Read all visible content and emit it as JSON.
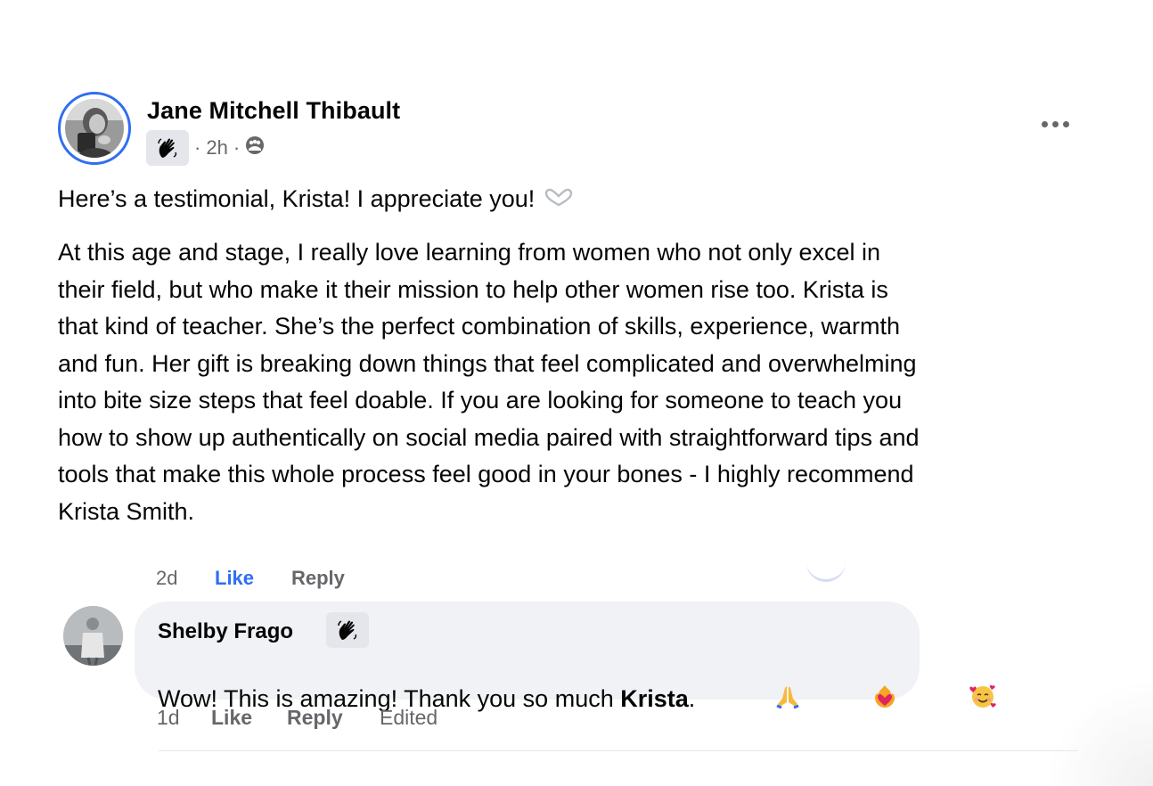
{
  "post": {
    "author": "Jane Mitchell Thibault",
    "badge_icon": "waving-hand-icon",
    "time": "2h",
    "separator": "·",
    "audience_icon": "group-audience-icon",
    "intro": "Here’s a testimonial, Krista! I appreciate you!",
    "intro_emoji": "heart-hands-icon",
    "body_lines": [
      "At this age and stage, I really love learning from women who not only excel in",
      "their field, but who make it their mission to help other women rise too. Krista is",
      "that kind of teacher. She’s the perfect combination of skills, experience, warmth",
      "and fun. Her gift is breaking down things that feel complicated and overwhelming",
      "into bite size steps that feel doable. If you are looking for someone to teach you",
      "how to show up authentically on social media paired with straightforward tips and",
      "tools that make this whole process feel good in your bones - I highly recommend",
      "Krista Smith."
    ]
  },
  "previous_comment_actions": {
    "time": "2d",
    "like": "Like",
    "reply": "Reply"
  },
  "comment": {
    "author": "Shelby Frago",
    "badge_icon": "waving-hand-icon",
    "text_before": "Wow! This is amazing! Thank you so much ",
    "mention": "Krista",
    "text_after": ".",
    "emojis": [
      "folded-hands-icon",
      "heart-on-fire-icon",
      "smiling-face-with-hearts-icon"
    ],
    "actions": {
      "time": "1d",
      "like": "Like",
      "reply": "Reply",
      "edited": "Edited"
    }
  },
  "colors": {
    "accent": "#2f6ef2",
    "secondary_text": "#65676b",
    "bubble": "#f0f2f5"
  }
}
